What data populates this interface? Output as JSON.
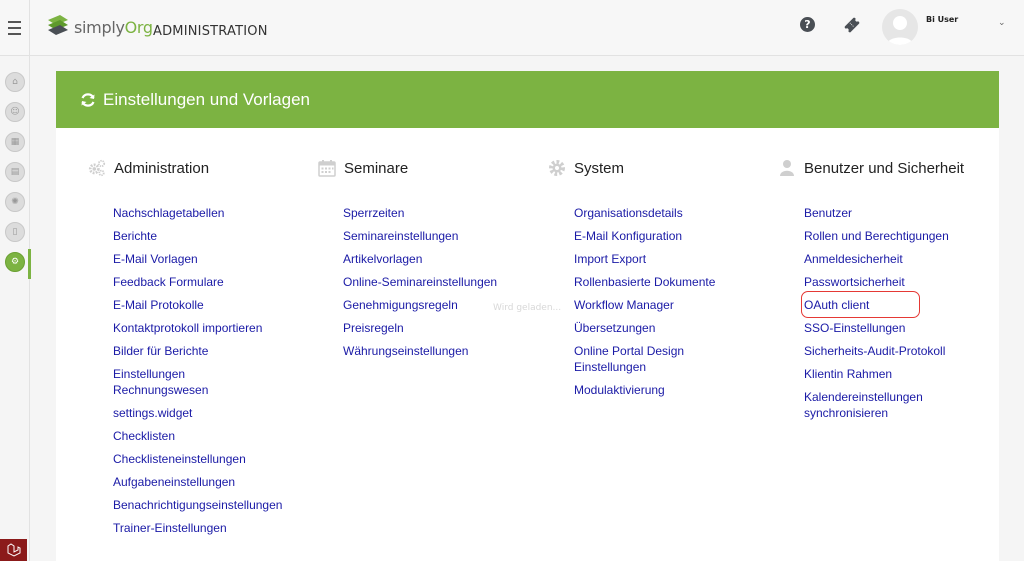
{
  "header": {
    "logo_plain": "simply",
    "logo_accent": "Org",
    "title": "ADMINISTRATION",
    "help_symbol": "?",
    "user_name": "Bi User",
    "chevron": "⌄"
  },
  "rail": {
    "items": [
      "home-icon",
      "users-icon",
      "building-icon",
      "calendar-icon",
      "sun-icon",
      "document-icon",
      "settings-icon"
    ],
    "bottom_icon": "laravel-icon"
  },
  "panel": {
    "title": "Einstellungen und Vorlagen"
  },
  "columns": [
    {
      "title": "Administration",
      "icon": "gears-icon",
      "links": [
        "Nachschlagetabellen",
        "Berichte",
        "E-Mail Vorlagen",
        "Feedback Formulare",
        "E-Mail Protokolle",
        "Kontaktprotokoll importieren",
        "Bilder für Berichte",
        "Einstellungen Rechnungswesen",
        "settings.widget",
        "Checklisten",
        "Checklisteneinstellungen",
        "Aufgabeneinstellungen",
        "Benachrichtigungseinstellungen",
        "Trainer-Einstellungen"
      ]
    },
    {
      "title": "Seminare",
      "icon": "calendar-icon",
      "links": [
        "Sperrzeiten",
        "Seminareinstellungen",
        "Artikelvorlagen",
        "Online-Seminareinstellungen",
        "Genehmigungsregeln",
        "Preisregeln",
        "Währungseinstellungen"
      ]
    },
    {
      "title": "System",
      "icon": "gear-icon",
      "links": [
        "Organisationsdetails",
        "E-Mail Konfiguration",
        "Import Export",
        "Rollenbasierte Dokumente",
        "Workflow Manager",
        "Übersetzungen",
        "Online Portal Design Einstellungen",
        "Modulaktivierung"
      ]
    },
    {
      "title": "Benutzer und Sicherheit",
      "icon": "user-icon",
      "links": [
        "Benutzer",
        "Rollen und Berechtigungen",
        "Anmeldesicherheit",
        "Passwortsicherheit",
        "OAuth client",
        "SSO-Einstellungen",
        "Sicherheits-Audit-Protokoll",
        "Klientin Rahmen",
        "Kalendereinstellungen synchronisieren"
      ]
    }
  ],
  "loading_text": "Wird geladen...",
  "colors": {
    "brand_green": "#7cb342",
    "link_blue": "#1a1aa6",
    "highlight_red": "#e53935"
  }
}
